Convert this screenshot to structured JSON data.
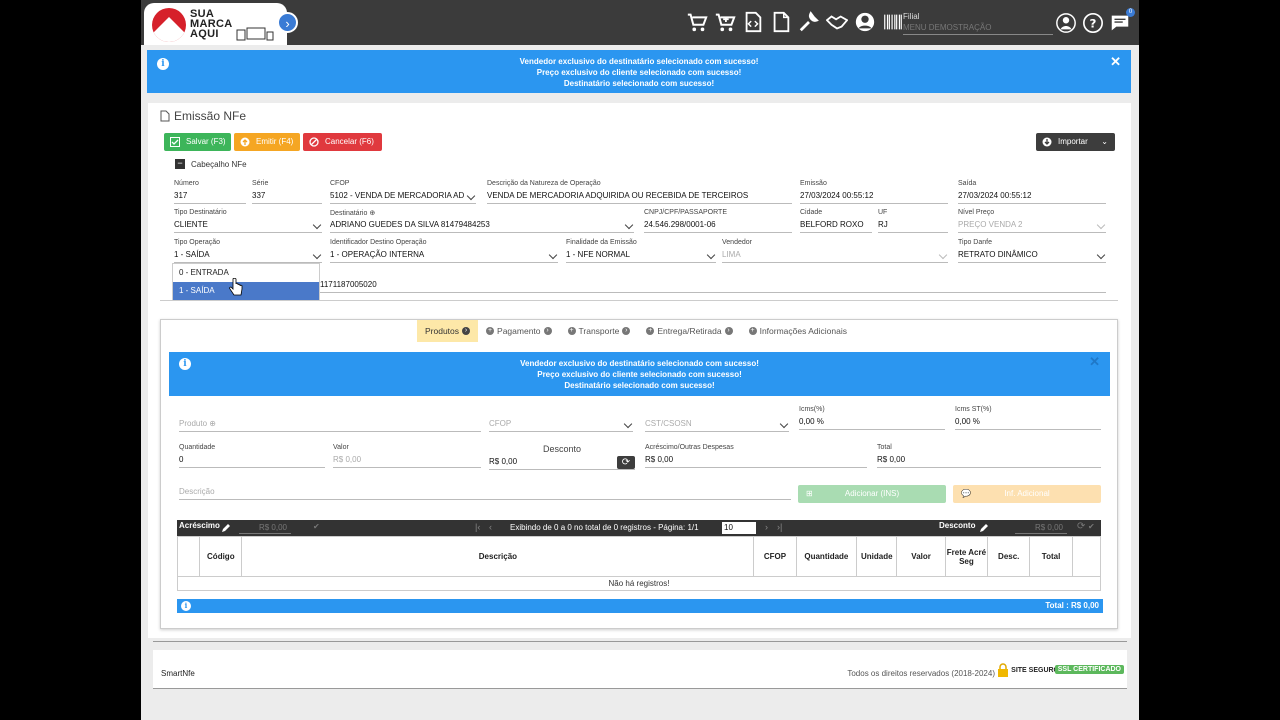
{
  "logo": {
    "line1": "SUA",
    "line2": "MARCA",
    "line3": "AQUI"
  },
  "topbar": {
    "icons": [
      "cart-icon",
      "cart-plus-icon",
      "code-file-icon",
      "document-icon",
      "wrench-icon",
      "handshake-icon",
      "user-circle-icon",
      "barcode-icon"
    ],
    "filial_label": "Filial",
    "filial_value": "MENU DEMOSTRAÇÃO",
    "notification_count": "0"
  },
  "alert": {
    "lines": [
      "Vendedor exclusivo do destinatário selecionado com sucesso!",
      "Preço exclusivo do cliente selecionado com sucesso!",
      "Destinatário selecionado com sucesso!"
    ]
  },
  "page": {
    "title": "Emissão NFe"
  },
  "actions": {
    "save": "Salvar (F3)",
    "emit": "Emitir (F4)",
    "cancel": "Cancelar (F6)",
    "import": "Importar"
  },
  "header_section": {
    "title": "Cabeçalho NFe"
  },
  "fields": {
    "numero": {
      "label": "Número",
      "value": "317"
    },
    "serie": {
      "label": "Série",
      "value": "337"
    },
    "cfop": {
      "label": "CFOP",
      "value": "5102 - VENDA DE MERCADORIA AD"
    },
    "natureza": {
      "label": "Descrição da Natureza de Operação",
      "value": "VENDA DE MERCADORIA ADQUIRIDA OU RECEBIDA DE TERCEIROS"
    },
    "emissao": {
      "label": "Emissão",
      "value": "27/03/2024 00:55:12"
    },
    "saida": {
      "label": "Saída",
      "value": "27/03/2024 00:55:12"
    },
    "tipo_destinatario": {
      "label": "Tipo Destinatário",
      "value": "CLIENTE"
    },
    "destinatario": {
      "label": "Destinatário",
      "value": "ADRIANO GUEDES DA SILVA 81479484253"
    },
    "cnpj": {
      "label": "CNPJ/CPF/PASSAPORTE",
      "value": "24.546.298/0001-06"
    },
    "cidade": {
      "label": "Cidade",
      "value": "BELFORD ROXO"
    },
    "uf": {
      "label": "UF",
      "value": "RJ"
    },
    "nivel_preco": {
      "label": "Nível Preço",
      "value": "PREÇO VENDA 2"
    },
    "tipo_operacao": {
      "label": "Tipo Operação",
      "value": "1 - SAÍDA"
    },
    "destino_operacao": {
      "label": "Identificador Destino Operação",
      "value": "1 - OPERAÇÃO INTERNA"
    },
    "finalidade": {
      "label": "Finalidade da Emissão",
      "value": "1 - NFE NORMAL"
    },
    "vendedor": {
      "label": "Vendedor",
      "value": "LIMA"
    },
    "tipo_danfe": {
      "label": "Tipo Danfe",
      "value": "RETRATO DINÂMICO"
    },
    "hidden_value": "1171187005020"
  },
  "dropdown": {
    "options": [
      "0 - ENTRADA",
      "1 - SAÍDA"
    ]
  },
  "tabs": [
    "Produtos",
    "Pagamento",
    "Transporte",
    "Entrega/Retirada",
    "Informações Adicionais"
  ],
  "product_form": {
    "produto": {
      "placeholder": "Produto"
    },
    "cfop": {
      "placeholder": "CFOP"
    },
    "cst": {
      "placeholder": "CST/CSOSN"
    },
    "icms": {
      "label": "Icms(%)",
      "value": "0,00 %"
    },
    "icms_st": {
      "label": "Icms ST(%)",
      "value": "0,00 %"
    },
    "quantidade": {
      "label": "Quantidade",
      "value": "0"
    },
    "valor": {
      "label": "Valor",
      "value": "R$ 0,00"
    },
    "desconto": {
      "label": "Desconto",
      "value": "R$ 0,00"
    },
    "acrescimo": {
      "label": "Acréscimo/Outras Despesas",
      "value": "R$ 0,00"
    },
    "total": {
      "label": "Total",
      "value": "R$ 0,00"
    },
    "descricao": {
      "placeholder": "Descrição"
    },
    "add_button": "Adicionar (INS)",
    "info_button": "Inf. Adicional"
  },
  "grid": {
    "acrescimo_label": "Acréscimo",
    "acrescimo_value": "R$ 0,00",
    "paging_text": "Exibindo de 0 a 0 no total de 0 registros - Página: 1/1",
    "page_size": "10",
    "desconto_label": "Desconto",
    "desconto_value": "R$ 0,00",
    "columns": [
      "",
      "Código",
      "Descrição",
      "CFOP",
      "Quantidade",
      "Unidade",
      "Valor",
      "Frete Acré Seg",
      "Desc.",
      "Total",
      ""
    ],
    "empty_text": "Não há registros!",
    "total_text": "Total : R$ 0,00"
  },
  "footer": {
    "brand": "SmartNfe",
    "rights": "Todos os direitos reservados (2018-2024)",
    "secure": "SITE SEGURO",
    "ssl": "SSL CERTIFICADO"
  }
}
